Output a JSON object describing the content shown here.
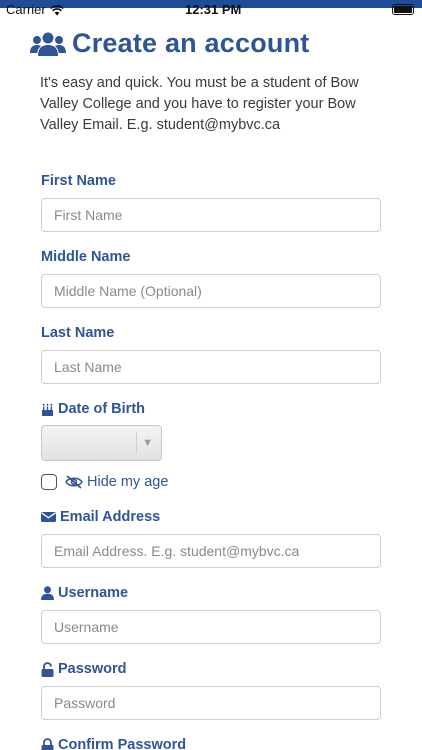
{
  "status_bar": {
    "carrier": "Carrier",
    "time": "12:31 PM"
  },
  "header": {
    "title": "Create an account"
  },
  "intro": "It's easy and quick. You must be a student of Bow Valley College and you have to register your Bow Valley Email. E.g. student@mybvc.ca",
  "fields": {
    "first_name": {
      "label": "First Name",
      "placeholder": "First Name",
      "value": ""
    },
    "middle_name": {
      "label": "Middle Name",
      "placeholder": "Middle Name (Optional)",
      "value": ""
    },
    "last_name": {
      "label": "Last Name",
      "placeholder": "Last Name",
      "value": ""
    },
    "dob": {
      "label": "Date of Birth",
      "selected": ""
    },
    "hide_age": {
      "label": "Hide my age",
      "checked": false
    },
    "email": {
      "label": "Email Address",
      "placeholder": "Email Address. E.g. student@mybvc.ca",
      "value": ""
    },
    "username": {
      "label": "Username",
      "placeholder": "Username",
      "value": ""
    },
    "password": {
      "label": "Password",
      "placeholder": "Password",
      "value": ""
    },
    "confirm_password": {
      "label": "Confirm Password"
    }
  },
  "colors": {
    "accent": "#2f5597",
    "status_stripe": "#1f4b99",
    "input_border": "#cfcfcf"
  },
  "icons": {
    "header": "users-icon",
    "dob": "birthday-cake-icon",
    "hide_age": "eye-slash-icon",
    "email": "envelope-icon",
    "username": "user-icon",
    "password": "lock-open-icon",
    "confirm_password": "lock-icon"
  }
}
